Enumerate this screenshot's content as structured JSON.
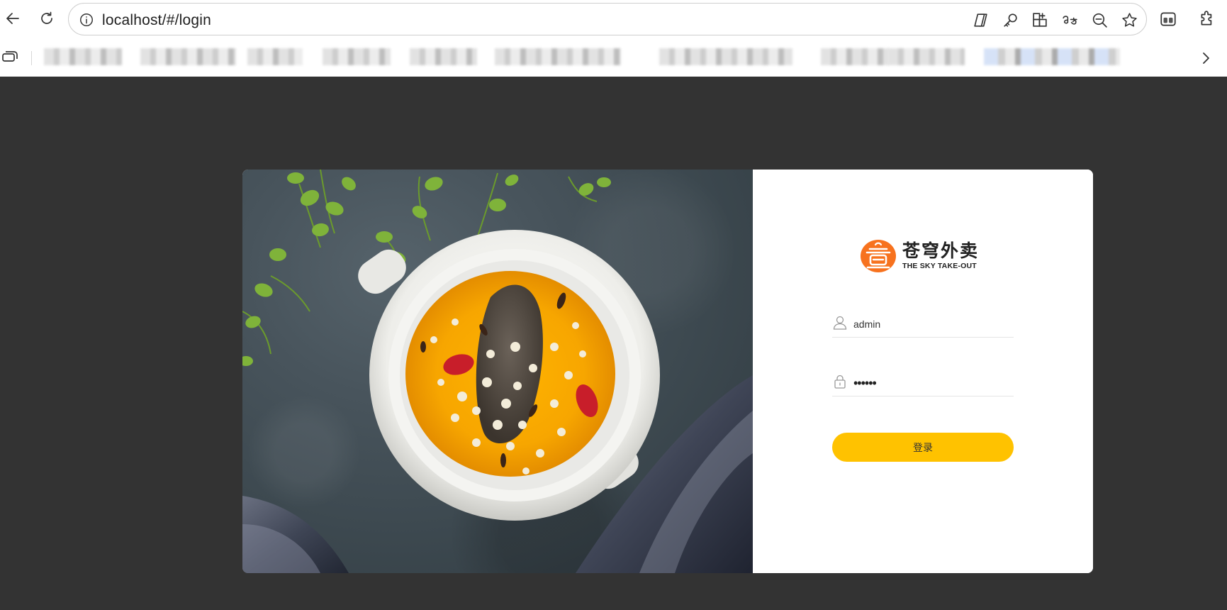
{
  "browser": {
    "url": "localhost/#/login",
    "bookmarks": [
      "",
      "",
      "",
      "",
      "",
      "",
      "",
      "",
      "",
      ""
    ]
  },
  "login": {
    "logo": {
      "title_cn": "苍穹外卖",
      "title_en": "THE SKY TAKE-OUT"
    },
    "username": {
      "value": "admin",
      "icon": "user-icon"
    },
    "password": {
      "value": "123456",
      "icon": "lock-icon"
    },
    "submit_label": "登录"
  },
  "colors": {
    "page_bg": "#333333",
    "accent": "#ffc200",
    "logo_orange": "#f7721e"
  }
}
